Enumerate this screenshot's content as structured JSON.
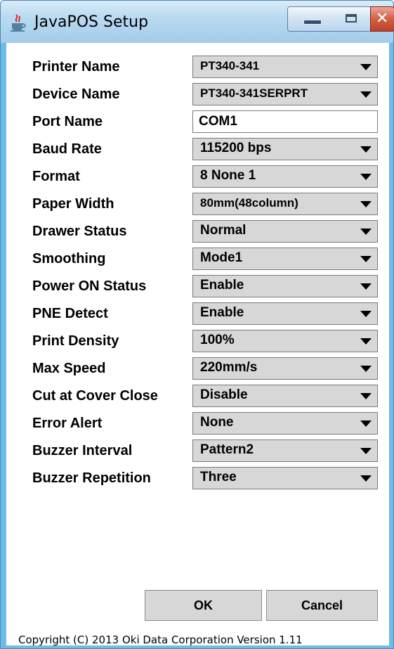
{
  "window": {
    "title": "JavaPOS Setup",
    "app_icon": "java-icon",
    "controls": [
      "minimize-icon",
      "maximize-icon",
      "close-icon"
    ],
    "colors": {
      "titlebar": "#b9daf1",
      "frame": "#6dbce6",
      "close": "#c0412a",
      "field_bg": "#d7d7d7"
    }
  },
  "settings": {
    "printer_name": {
      "label": "Printer Name",
      "value": "PT340-341"
    },
    "device_name": {
      "label": "Device Name",
      "value": "PT340-341SERPRT"
    },
    "port_name": {
      "label": "Port Name",
      "value": "COM1"
    },
    "baud_rate": {
      "label": "Baud Rate",
      "value": "115200 bps"
    },
    "format": {
      "label": "Format",
      "value": "8 None 1"
    },
    "paper_width": {
      "label": "Paper Width",
      "value": "80mm(48column)"
    },
    "drawer_status": {
      "label": "Drawer Status",
      "value": "Normal"
    },
    "smoothing": {
      "label": "Smoothing",
      "value": "Mode1"
    },
    "power_on_status": {
      "label": "Power ON Status",
      "value": "Enable"
    },
    "pne_detect": {
      "label": "PNE Detect",
      "value": "Enable"
    },
    "print_density": {
      "label": "Print Density",
      "value": "100%"
    },
    "max_speed": {
      "label": "Max Speed",
      "value": "220mm/s"
    },
    "cut_at_cover_close": {
      "label": "Cut at Cover Close",
      "value": "Disable"
    },
    "error_alert": {
      "label": "Error Alert",
      "value": "None"
    },
    "buzzer_interval": {
      "label": "Buzzer Interval",
      "value": "Pattern2"
    },
    "buzzer_repetition": {
      "label": "Buzzer Repetition",
      "value": "Three"
    }
  },
  "buttons": {
    "ok": "OK",
    "cancel": "Cancel"
  },
  "footer": {
    "copyright": "Copyright (C) 2013 Oki Data Corporation Version 1.11"
  }
}
